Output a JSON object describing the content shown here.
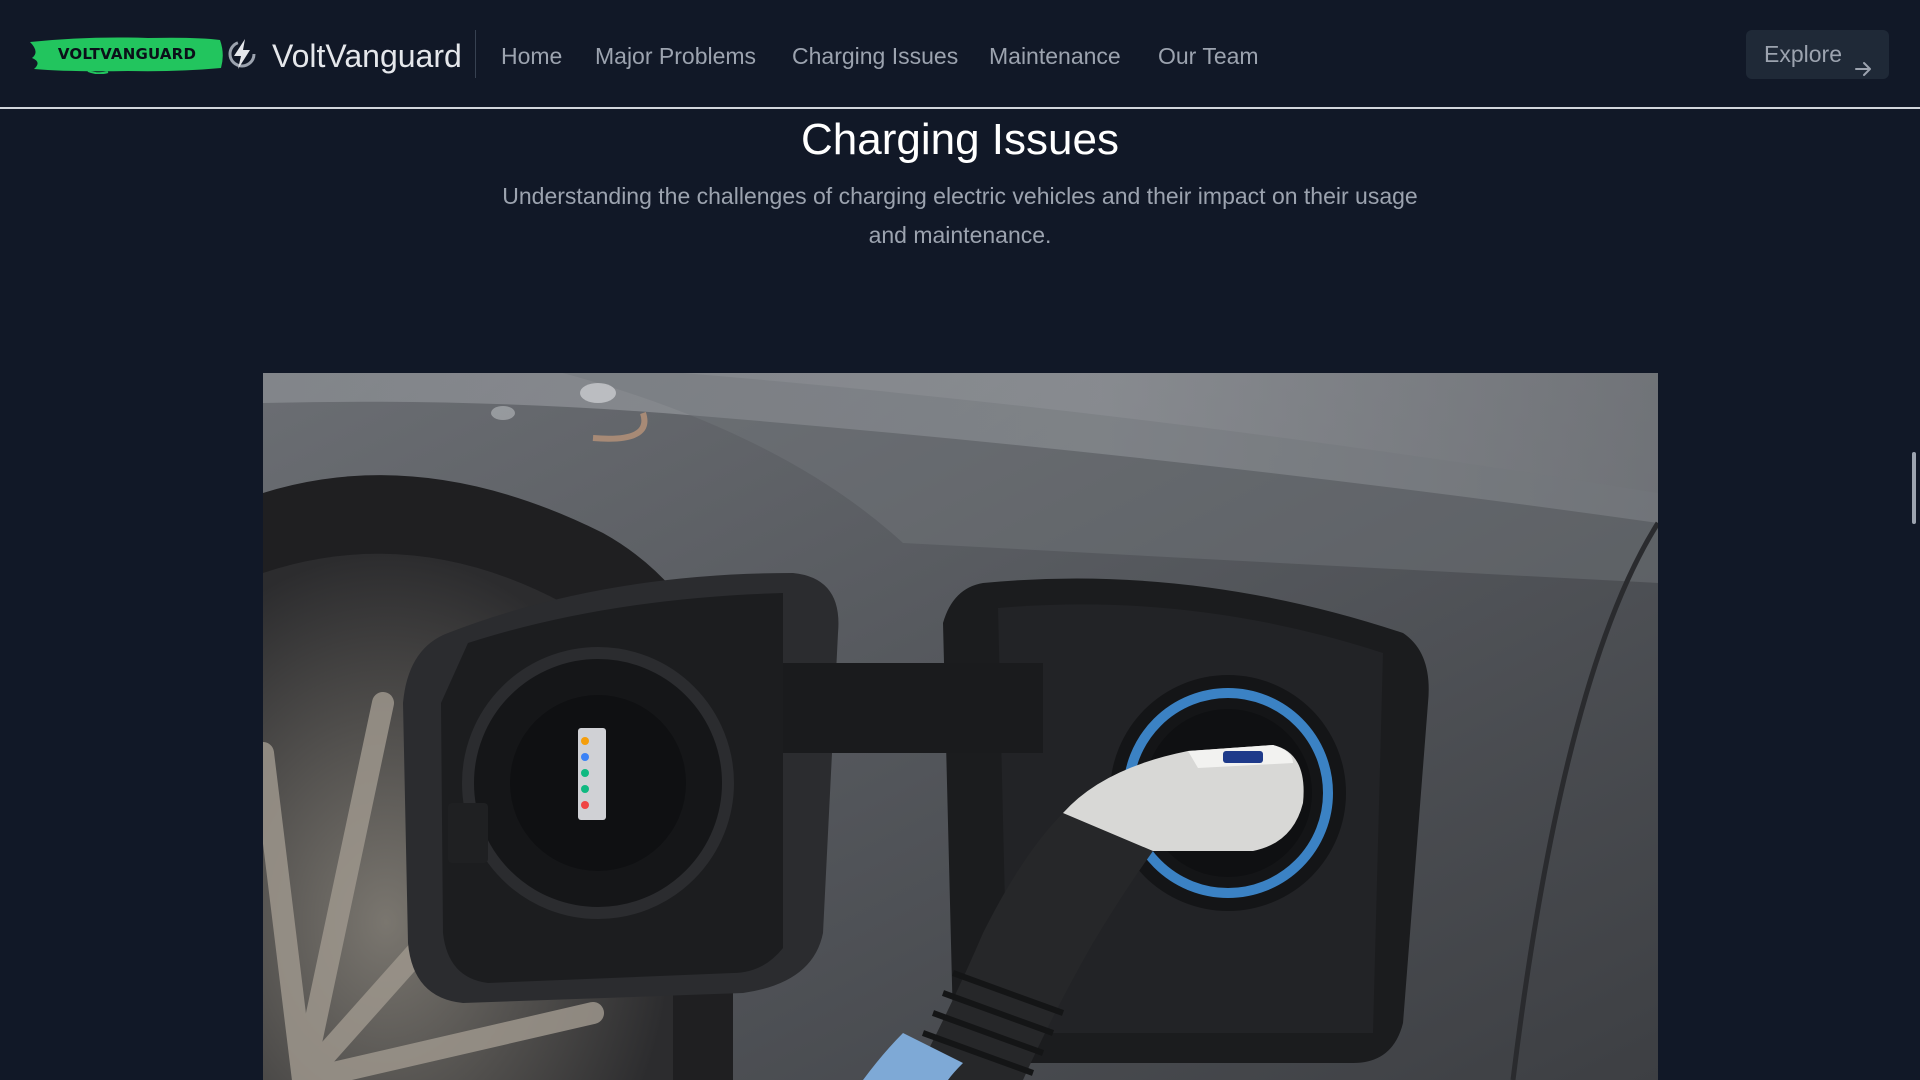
{
  "header": {
    "badge_text": "VOLTVANGUARD",
    "brand_name": "VoltVanguard",
    "nav": [
      {
        "label": "Home"
      },
      {
        "label": "Major Problems"
      },
      {
        "label": "Charging Issues"
      },
      {
        "label": "Maintenance"
      },
      {
        "label": "Our Team"
      }
    ],
    "explore_label": "Explore",
    "icons": {
      "logo": "lightning-bolt-icon",
      "explore": "arrow-right-icon"
    }
  },
  "hero": {
    "title": "Charging Issues",
    "subtitle": "Understanding the challenges of charging electric vehicles and their impact on their usage and maintenance."
  },
  "image": {
    "subject": "Electric car charging port with plugged-in charger"
  },
  "colors": {
    "background": "#111827",
    "badge": "#22c55e",
    "nav_text": "#9ca3af",
    "title": "#ffffff",
    "button_bg": "#1f2937"
  }
}
